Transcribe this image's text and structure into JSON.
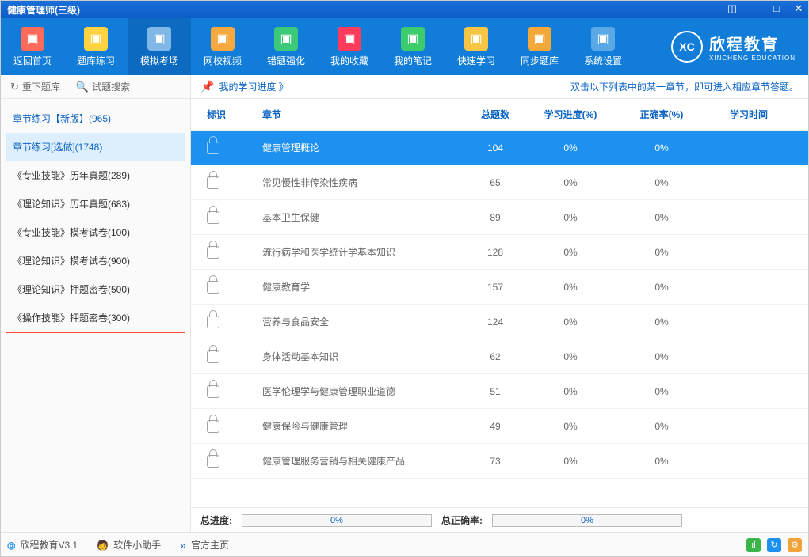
{
  "window": {
    "title": "健康管理师(三级)"
  },
  "nav": {
    "items": [
      {
        "label": "返回首页",
        "icon": "home"
      },
      {
        "label": "题库练习",
        "icon": "practice"
      },
      {
        "label": "模拟考场",
        "icon": "sim"
      },
      {
        "label": "网校视频",
        "icon": "video"
      },
      {
        "label": "错题强化",
        "icon": "wrong"
      },
      {
        "label": "我的收藏",
        "icon": "fav"
      },
      {
        "label": "我的笔记",
        "icon": "note"
      },
      {
        "label": "快速学习",
        "icon": "fast"
      },
      {
        "label": "同步题库",
        "icon": "sync"
      },
      {
        "label": "系统设置",
        "icon": "set"
      }
    ],
    "brand": {
      "logo": "XC",
      "name": "欣程教育",
      "sub": "XINCHENG EDUCATION"
    }
  },
  "sidebar": {
    "tools": {
      "refresh": "重下题库",
      "search": "试题搜索"
    },
    "items": [
      "章节练习【新版】(965)",
      "章节练习[选做](1748)",
      "《专业技能》历年真题(289)",
      "《理论知识》历年真题(683)",
      "《专业技能》模考试卷(100)",
      "《理论知识》模考试卷(900)",
      "《理论知识》押题密卷(500)",
      "《操作技能》押题密卷(300)"
    ]
  },
  "info": {
    "progress_label": "我的学习进度 》",
    "tip": "双击以下列表中的某一章节，即可进入相应章节答题。"
  },
  "table": {
    "head": {
      "flag": "标识",
      "chapter": "章节",
      "total": "总题数",
      "progress": "学习进度(%)",
      "accuracy": "正确率(%)",
      "time": "学习时间"
    },
    "rows": [
      {
        "chapter": "健康管理概论",
        "total": "104",
        "progress": "0%",
        "accuracy": "0%"
      },
      {
        "chapter": "常见慢性非传染性疾病",
        "total": "65",
        "progress": "0%",
        "accuracy": "0%"
      },
      {
        "chapter": "基本卫生保健",
        "total": "89",
        "progress": "0%",
        "accuracy": "0%"
      },
      {
        "chapter": "流行病学和医学统计学基本知识",
        "total": "128",
        "progress": "0%",
        "accuracy": "0%"
      },
      {
        "chapter": "健康教育学",
        "total": "157",
        "progress": "0%",
        "accuracy": "0%"
      },
      {
        "chapter": "营养与食品安全",
        "total": "124",
        "progress": "0%",
        "accuracy": "0%"
      },
      {
        "chapter": "身体活动基本知识",
        "total": "62",
        "progress": "0%",
        "accuracy": "0%"
      },
      {
        "chapter": "医学伦理学与健康管理职业道德",
        "total": "51",
        "progress": "0%",
        "accuracy": "0%"
      },
      {
        "chapter": "健康保险与健康管理",
        "total": "49",
        "progress": "0%",
        "accuracy": "0%"
      },
      {
        "chapter": "健康管理服务营销与相关健康产品",
        "total": "73",
        "progress": "0%",
        "accuracy": "0%"
      }
    ]
  },
  "summary": {
    "total_label": "总进度:",
    "total_val": "0%",
    "acc_label": "总正确率:",
    "acc_val": "0%"
  },
  "status": {
    "app": "欣程教育V3.1",
    "helper": "软件小助手",
    "home": "官方主页"
  }
}
